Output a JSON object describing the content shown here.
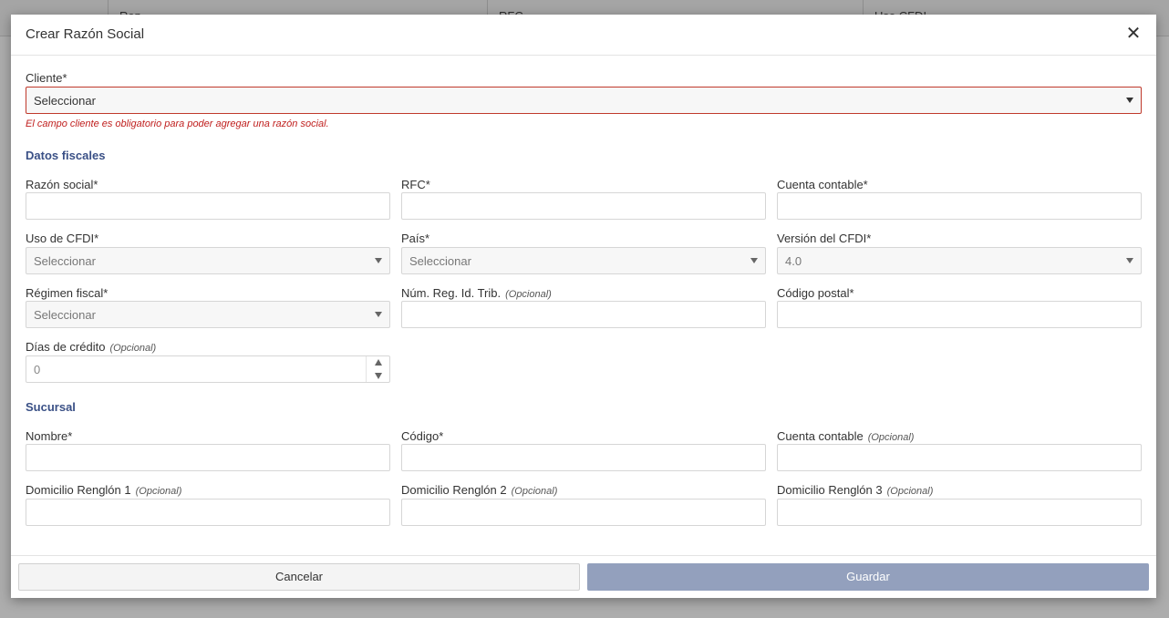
{
  "background": {
    "columns": [
      "Raz...",
      "RFC",
      "Uso CFDI"
    ]
  },
  "modal": {
    "title": "Crear Razón Social",
    "close_icon": "close-icon"
  },
  "cliente": {
    "label": "Cliente*",
    "value": "Seleccionar",
    "error": "El campo cliente es obligatorio para poder agregar una razón social."
  },
  "datos_fiscales": {
    "title": "Datos fiscales",
    "razon_social": {
      "label": "Razón social*",
      "value": ""
    },
    "rfc": {
      "label": "RFC*",
      "value": ""
    },
    "cuenta_contable": {
      "label": "Cuenta contable*",
      "value": ""
    },
    "uso_cfdi": {
      "label": "Uso de CFDI*",
      "value": "Seleccionar"
    },
    "pais": {
      "label": "País*",
      "value": "Seleccionar"
    },
    "version_cfdi": {
      "label": "Versión del CFDI*",
      "value": "4.0"
    },
    "regimen_fiscal": {
      "label": "Régimen fiscal*",
      "value": "Seleccionar"
    },
    "num_reg_id_trib": {
      "label": "Núm. Reg. Id. Trib.",
      "optional": "(Opcional)",
      "value": ""
    },
    "codigo_postal": {
      "label": "Código postal*",
      "value": ""
    },
    "dias_credito": {
      "label": "Días de crédito",
      "optional": "(Opcional)",
      "value": "0"
    }
  },
  "sucursal": {
    "title": "Sucursal",
    "nombre": {
      "label": "Nombre*",
      "value": ""
    },
    "codigo": {
      "label": "Código*",
      "value": ""
    },
    "cuenta_contable": {
      "label": "Cuenta contable",
      "optional": "(Opcional)",
      "value": ""
    },
    "domicilio1": {
      "label": "Domicilio Renglón 1",
      "optional": "(Opcional)",
      "value": ""
    },
    "domicilio2": {
      "label": "Domicilio Renglón 2",
      "optional": "(Opcional)",
      "value": ""
    },
    "domicilio3": {
      "label": "Domicilio Renglón 3",
      "optional": "(Opcional)",
      "value": ""
    }
  },
  "footer": {
    "cancel_label": "Cancelar",
    "save_label": "Guardar"
  },
  "colors": {
    "accent": "#3a5086",
    "error": "#c0201f",
    "save_button": "#93a0bd"
  }
}
